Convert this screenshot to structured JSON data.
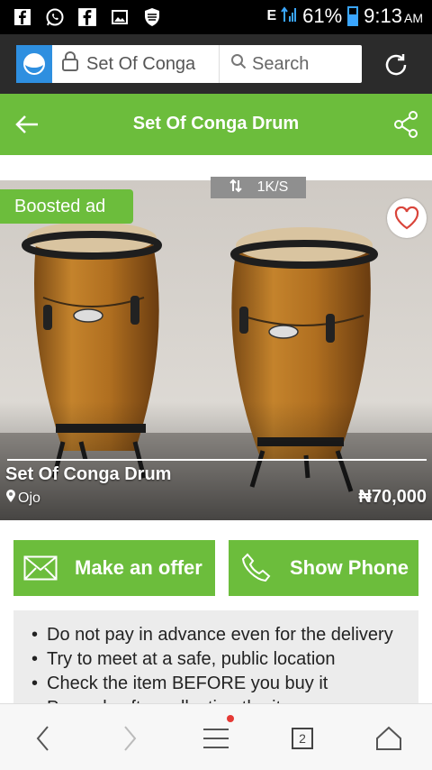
{
  "status_bar": {
    "network_label": "E",
    "battery_percent": "61%",
    "time": "9:13",
    "ampm": "AM",
    "icons": [
      "facebook-icon",
      "whatsapp-icon",
      "facebook-icon",
      "image-icon",
      "shield-icon"
    ]
  },
  "browser": {
    "url_text": "Set Of Conga",
    "search_placeholder": "Search"
  },
  "header": {
    "title": "Set Of Conga Drum"
  },
  "image_overlay": {
    "speed_text": "1K/S",
    "boosted_label": "Boosted ad",
    "title": "Set Of Conga Drum",
    "location": "Ojo",
    "price": "₦70,000"
  },
  "actions": {
    "offer_label": "Make an offer",
    "phone_label": "Show Phone"
  },
  "tips": {
    "items": [
      "Do not pay in advance even for the delivery",
      "Try to meet at a safe, public location",
      "Check the item BEFORE you buy it",
      "Pay only after collecting the item"
    ]
  },
  "bottom_nav": {
    "tab_count": "2"
  },
  "colors": {
    "accent": "#6cbd3c",
    "browser_bar": "#2b2b2b",
    "status_bar": "#000000",
    "site_logo": "#2e8fe0"
  }
}
